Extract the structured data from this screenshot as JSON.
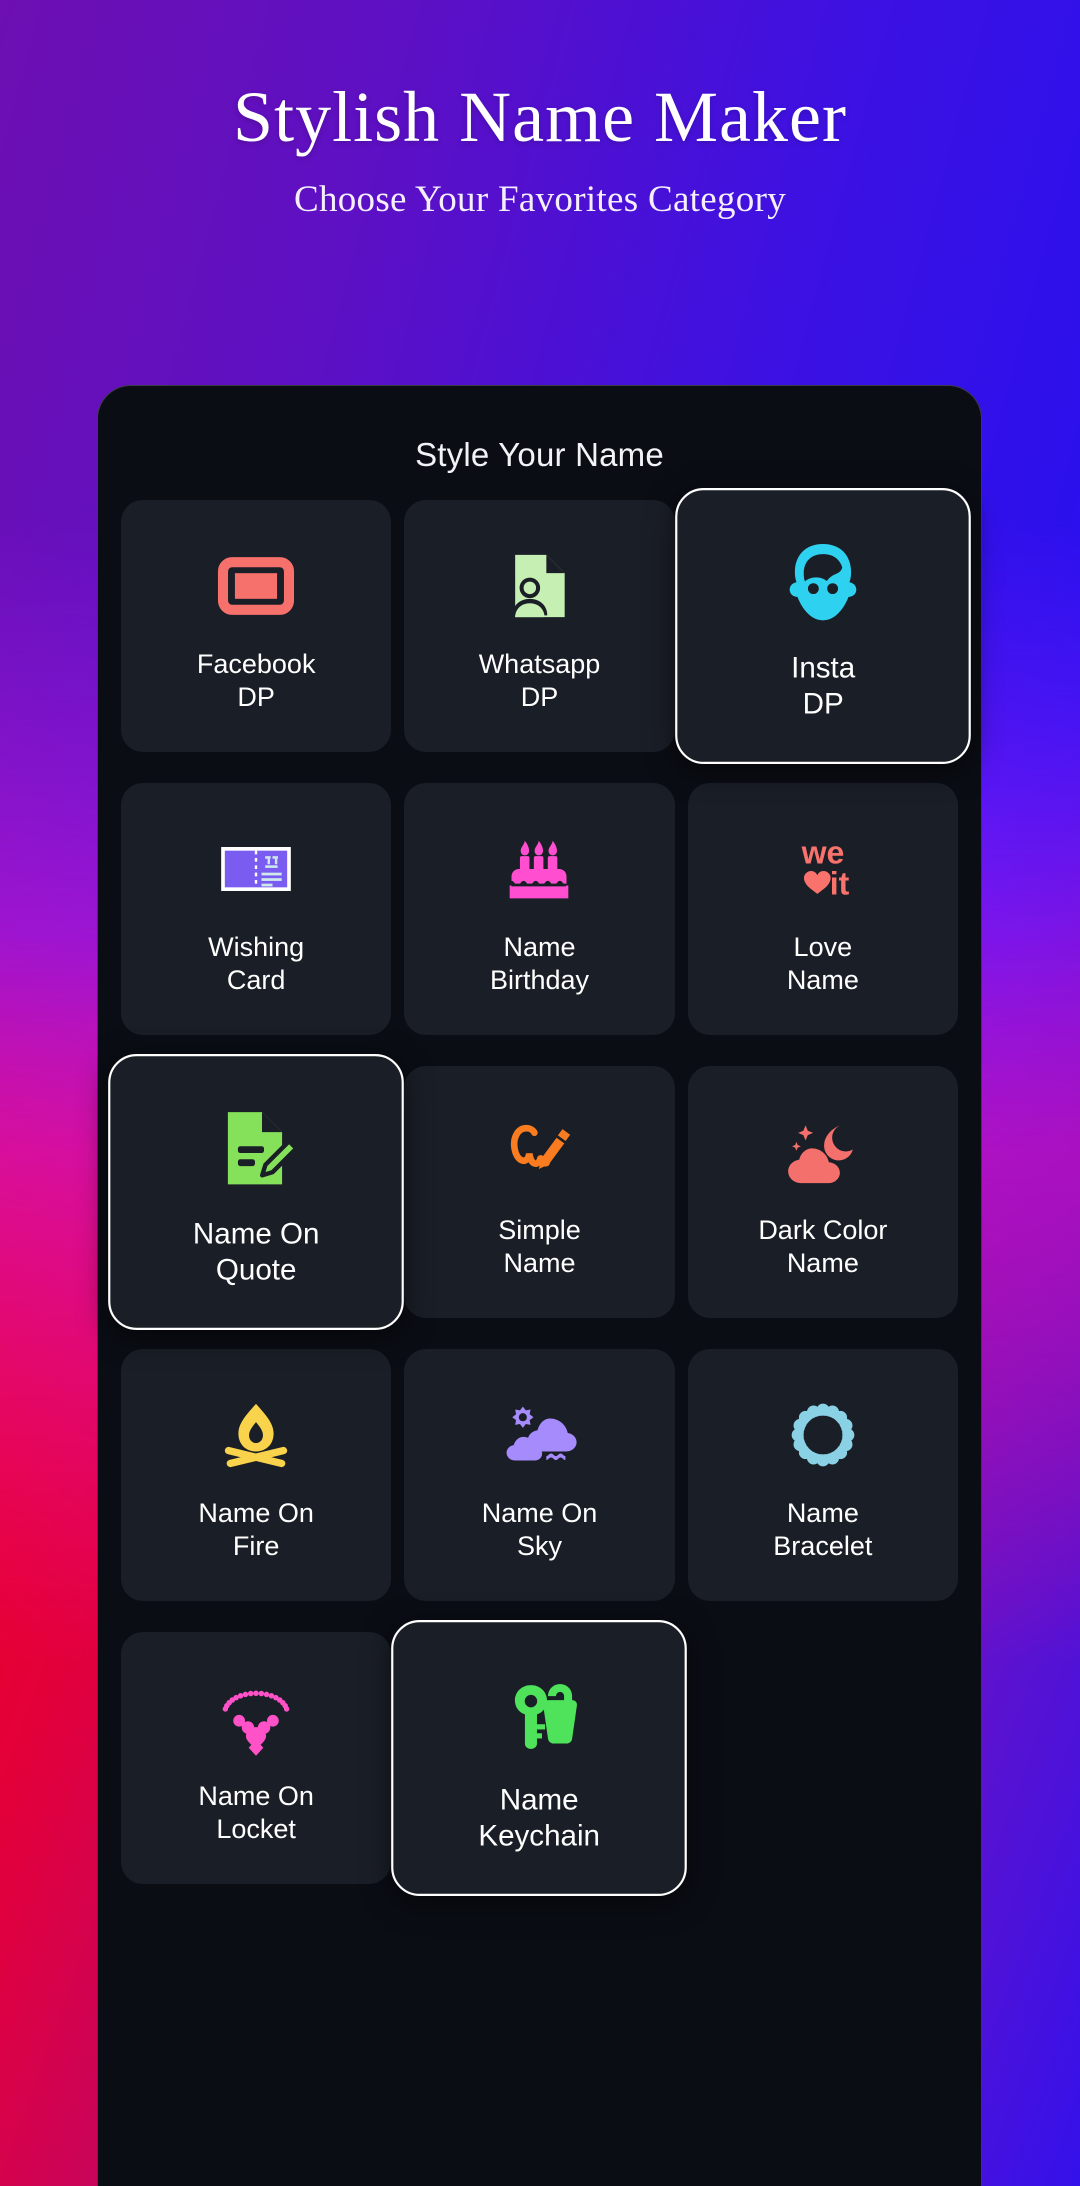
{
  "header": {
    "title": "Stylish Name Maker",
    "subtitle": "Choose Your Favorites Category"
  },
  "panel": {
    "title": "Style Your Name"
  },
  "colors": {
    "panel_bg": "#0a0d14",
    "tile_bg": "#1a1e26",
    "selected_border": "#ffffff",
    "text": "#ffffff",
    "bg_gradient_start": "#6a0dad",
    "bg_gradient_mid": "#2310f2",
    "bg_gradient_end": "#f20016"
  },
  "tiles": [
    {
      "id": "facebook-dp",
      "label": "Facebook\nDP",
      "icon": "photo-frame-icon",
      "icon_color": "#f7716c",
      "selected": false
    },
    {
      "id": "whatsapp-dp",
      "label": "Whatsapp\nDP",
      "icon": "profile-document-icon",
      "icon_color": "#c6efb3",
      "selected": false
    },
    {
      "id": "insta-dp",
      "label": "Insta\nDP",
      "icon": "face-avatar-icon",
      "icon_color": "#2ed2f0",
      "selected": true
    },
    {
      "id": "wishing-card",
      "label": "Wishing\nCard",
      "icon": "greeting-card-icon",
      "icon_color": "#7a5cf0",
      "selected": false
    },
    {
      "id": "name-birthday",
      "label": "Name\nBirthday",
      "icon": "birthday-cake-icon",
      "icon_color": "#ff4fd0",
      "selected": false
    },
    {
      "id": "love-name",
      "label": "Love\nName",
      "icon": "we-heart-it-icon",
      "icon_color": "#f9736c",
      "selected": false
    },
    {
      "id": "name-on-quote",
      "label": "Name On\nQuote",
      "icon": "document-pen-icon",
      "icon_color": "#85e05a",
      "selected": true
    },
    {
      "id": "simple-name",
      "label": "Simple\nName",
      "icon": "signature-pencil-icon",
      "icon_color": "#f97d20",
      "selected": false
    },
    {
      "id": "dark-color-name",
      "label": "Dark Color\nName",
      "icon": "cloud-moon-icon",
      "icon_color": "#f4706c",
      "selected": false
    },
    {
      "id": "name-on-fire",
      "label": "Name On\nFire",
      "icon": "campfire-icon",
      "icon_color": "#f8d34b",
      "selected": false
    },
    {
      "id": "name-on-sky",
      "label": "Name On\nSky",
      "icon": "sun-clouds-icon",
      "icon_color": "#a58bfb",
      "selected": false
    },
    {
      "id": "name-bracelet",
      "label": "Name\nBracelet",
      "icon": "beaded-bracelet-icon",
      "icon_color": "#8ad1e6",
      "selected": false
    },
    {
      "id": "name-on-locket",
      "label": "Name On\nLocket",
      "icon": "necklace-locket-icon",
      "icon_color": "#ff52c8",
      "selected": false
    },
    {
      "id": "name-keychain",
      "label": "Name\nKeychain",
      "icon": "key-tag-icon",
      "icon_color": "#4ee35a",
      "selected": true
    }
  ]
}
